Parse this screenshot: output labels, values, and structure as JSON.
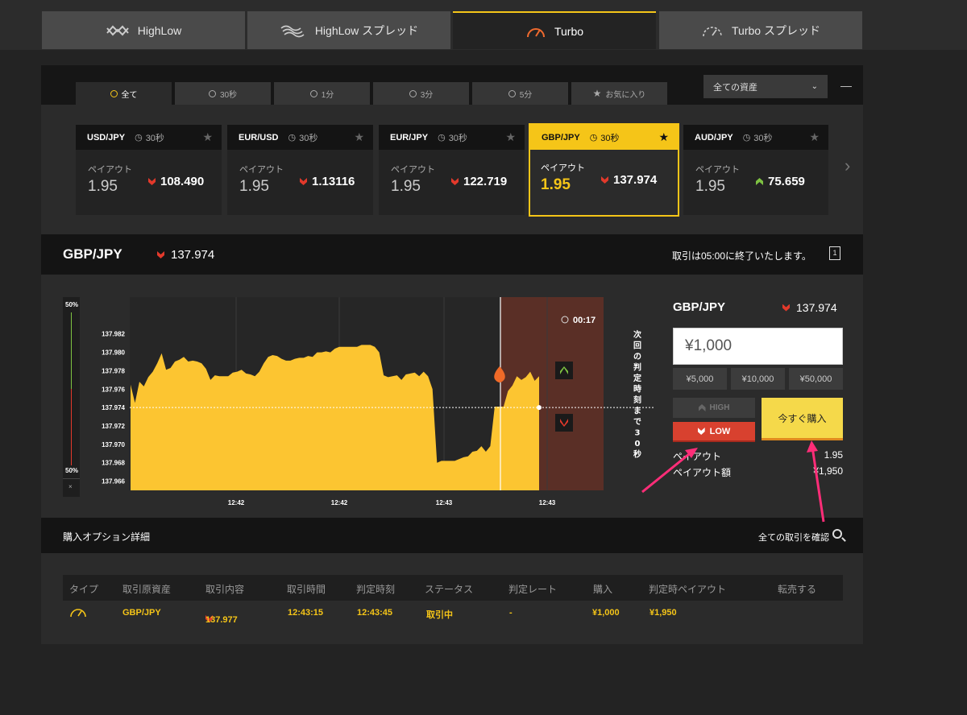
{
  "colors": {
    "accent": "#f5c518",
    "low": "#d8412f",
    "up": "#7ec242",
    "down": "#e2392b",
    "chart_fill": "#fcc531",
    "arrow": "#ff2d78"
  },
  "main_tabs": [
    {
      "label": "HighLow",
      "icon": "highlow-icon"
    },
    {
      "label": "HighLow スプレッド",
      "icon": "highlow-spread-icon"
    },
    {
      "label": "Turbo",
      "icon": "turbo-gauge-icon"
    },
    {
      "label": "Turbo スプレッド",
      "icon": "turbo-spread-icon"
    }
  ],
  "filter_tabs": [
    {
      "label": "全て",
      "icon": "clock-icon"
    },
    {
      "label": "30秒",
      "icon": "clock-icon"
    },
    {
      "label": "1分",
      "icon": "clock-icon"
    },
    {
      "label": "3分",
      "icon": "clock-icon"
    },
    {
      "label": "5分",
      "icon": "clock-icon"
    },
    {
      "label": "お気に入り",
      "icon": "star-icon"
    }
  ],
  "asset_select": {
    "value": "全ての資産"
  },
  "asset_cards": [
    {
      "pair": "USD/JPY",
      "duration": "30秒",
      "payout_label": "ペイアウト",
      "payout": "1.95",
      "rate": "108.490",
      "dir": "down"
    },
    {
      "pair": "EUR/USD",
      "duration": "30秒",
      "payout_label": "ペイアウト",
      "payout": "1.95",
      "rate": "1.13116",
      "dir": "down"
    },
    {
      "pair": "EUR/JPY",
      "duration": "30秒",
      "payout_label": "ペイアウト",
      "payout": "1.95",
      "rate": "122.719",
      "dir": "down"
    },
    {
      "pair": "GBP/JPY",
      "duration": "30秒",
      "payout_label": "ペイアウト",
      "payout": "1.95",
      "rate": "137.974",
      "dir": "down"
    },
    {
      "pair": "AUD/JPY",
      "duration": "30秒",
      "payout_label": "ペイアウト",
      "payout": "1.95",
      "rate": "75.659",
      "dir": "up"
    }
  ],
  "selected": {
    "pair": "GBP/JPY",
    "rate": "137.974",
    "close_msg": "取引は05:00に終了いたします。",
    "layout_icon_text": "1"
  },
  "gauge": {
    "top": "50%",
    "bottom": "50%",
    "close": "×"
  },
  "chart_data": {
    "type": "area",
    "yticks": [
      "137.982",
      "137.980",
      "137.978",
      "137.976",
      "137.974",
      "137.972",
      "137.970",
      "137.968",
      "137.966"
    ],
    "xticks": [
      "12:42",
      "12:42",
      "12:43",
      "12:43"
    ],
    "ylim": [
      137.965,
      137.986
    ],
    "values": [
      137.9765,
      137.9745,
      137.9768,
      137.9763,
      137.9773,
      137.9779,
      137.9788,
      137.9799,
      137.9781,
      137.9783,
      137.979,
      137.9792,
      137.9795,
      137.979,
      137.9791,
      137.979,
      137.9788,
      137.9782,
      137.977,
      137.9775,
      137.9774,
      137.9774,
      137.9774,
      137.9778,
      137.9779,
      137.9781,
      137.9777,
      137.9776,
      137.9774,
      137.9779,
      137.9788,
      137.9795,
      137.9797,
      137.9796,
      137.9793,
      137.9791,
      137.9791,
      137.9793,
      137.9794,
      137.9794,
      137.9796,
      137.9795,
      137.98,
      137.98,
      137.9801,
      137.98,
      137.9804,
      137.9806,
      137.9806,
      137.9806,
      137.9806,
      137.9806,
      137.9808,
      137.9808,
      137.9808,
      137.9806,
      137.98,
      137.9775,
      137.9773,
      137.9774,
      137.9775,
      137.977,
      137.9776,
      137.9777,
      137.9778,
      137.9774,
      137.9779,
      137.9774,
      137.976,
      137.968,
      137.9682,
      137.9682,
      137.9682,
      137.9682,
      137.9684,
      137.9686,
      137.9687,
      137.9692,
      137.9693,
      137.9698,
      137.9692,
      137.9698,
      137.9741,
      137.9741,
      137.9741,
      137.9758,
      137.9764,
      137.9774,
      137.977,
      137.9773,
      137.9779,
      137.9769,
      137.9774
    ],
    "current_rate": 137.974,
    "countdown": "00:17",
    "side_label": "次回の判定時刻まで30秒"
  },
  "trade": {
    "pair": "GBP/JPY",
    "rate": "137.974",
    "amount": "¥1,000",
    "quick_amounts": [
      "¥5,000",
      "¥10,000",
      "¥50,000"
    ],
    "high_label": "HIGH",
    "low_label": "LOW",
    "buy_label": "今すぐ購入",
    "payout_label": "ペイアウト",
    "payout_value": "1.95",
    "payout_amount_label": "ペイアウト額",
    "payout_amount_value": "¥1,950"
  },
  "details": {
    "title": "購入オプション詳細",
    "link": "全ての取引を確認",
    "columns": [
      "タイプ",
      "取引原資産",
      "取引内容",
      "取引時間",
      "判定時刻",
      "ステータス",
      "判定レート",
      "購入",
      "判定時ペイアウト",
      "転売する"
    ],
    "rows": [
      {
        "type_icon": "turbo-gauge-icon",
        "asset": "GBP/JPY",
        "content": "137.977",
        "time": "12:43:15",
        "judge_time": "12:43:45",
        "status": "取引中",
        "judge_rate": "-",
        "purchase": "¥1,000",
        "payout": "¥1,950",
        "resale": ""
      }
    ]
  }
}
